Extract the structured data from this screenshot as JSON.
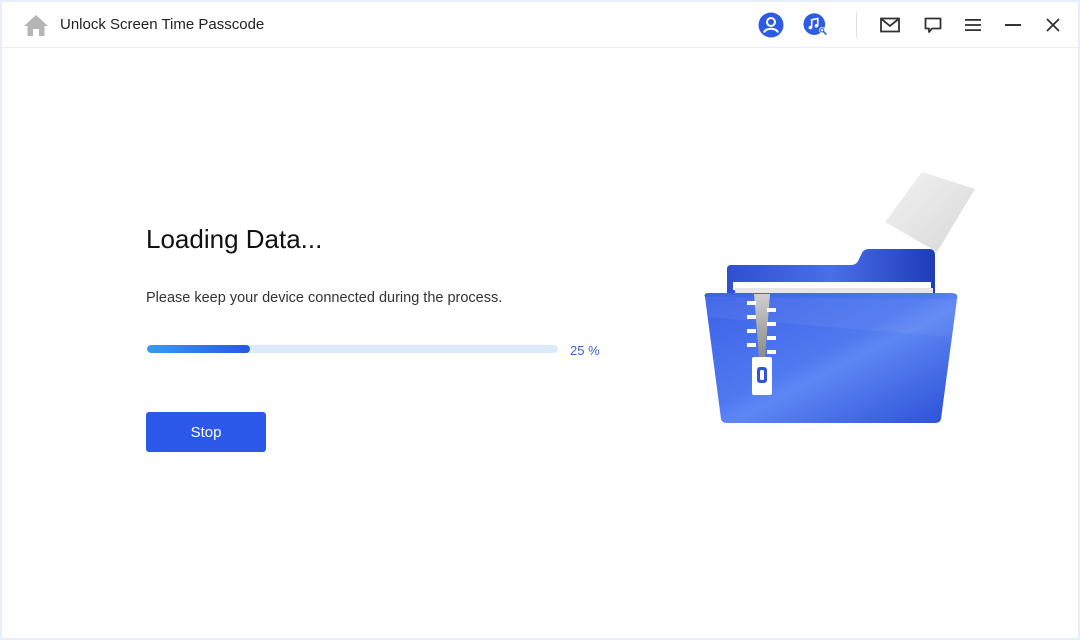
{
  "header": {
    "title": "Unlock Screen Time Passcode",
    "icons": [
      "home-icon",
      "user-account-icon",
      "music-search-icon",
      "mail-icon",
      "feedback-icon",
      "menu-icon",
      "minimize-icon",
      "close-icon"
    ]
  },
  "main": {
    "heading": "Loading Data...",
    "subtitle": "Please keep your device connected during the process.",
    "progress": {
      "percent": 25,
      "label": "25 %"
    },
    "stop_label": "Stop"
  },
  "colors": {
    "accent": "#2b58e8",
    "icon_blue": "#2d5be3",
    "progress_track": "#dcebfb",
    "progress_label": "#3a5fd8"
  }
}
